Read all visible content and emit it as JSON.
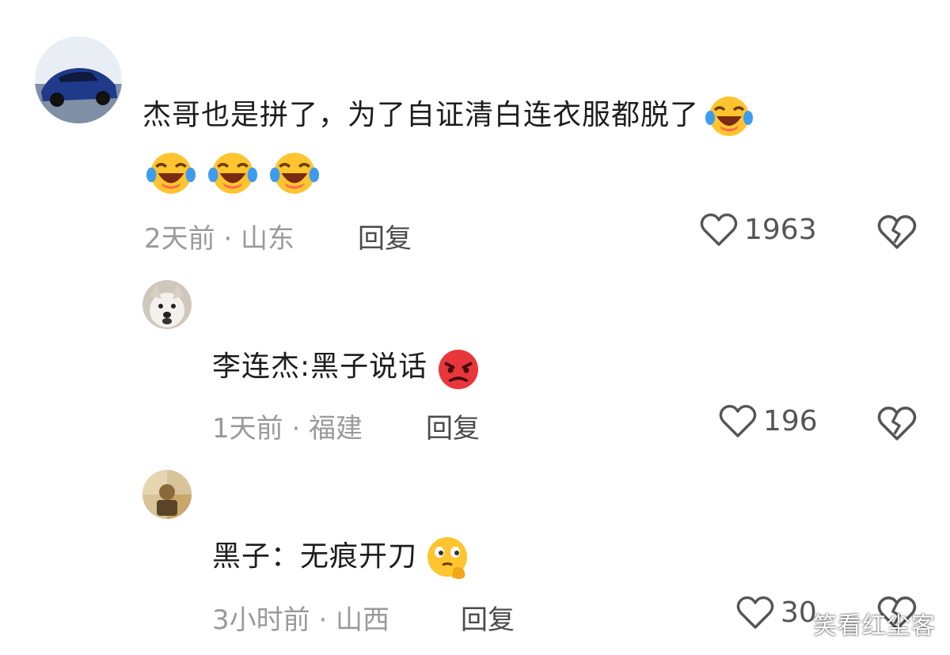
{
  "comments": [
    {
      "text": "杰哥也是拼了，为了自证清白连衣服都脱了",
      "time_location": "2天前 · 山东",
      "reply_label": "回复",
      "likes": "1963",
      "emojis": [
        "laughing-crying-emoji",
        "laughing-crying-emoji",
        "laughing-crying-emoji",
        "laughing-crying-emoji"
      ]
    },
    {
      "text": "李连杰:黑子说话",
      "time_location": "1天前 · 福建",
      "reply_label": "回复",
      "likes": "196",
      "emojis": [
        "angry-face-emoji"
      ]
    },
    {
      "text": "黑子：无痕开刀",
      "time_location": "3小时前 · 山西",
      "reply_label": "回复",
      "likes": "30",
      "emojis": [
        "thinking-face-emoji"
      ]
    }
  ],
  "watermark": "笑看红尘客",
  "colors": {
    "text": "#1d1d1d",
    "meta": "#9a9a9a",
    "icon": "#555555",
    "emoji_yellow": "#ffc42e",
    "emoji_red": "#e8373c"
  }
}
